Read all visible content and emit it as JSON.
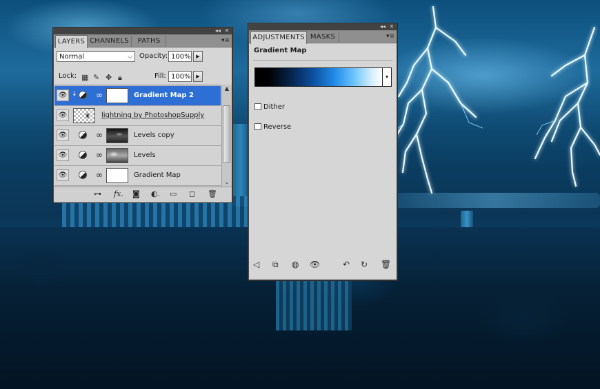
{
  "layers_panel": {
    "tabs": [
      "LAYERS",
      "CHANNELS",
      "PATHS"
    ],
    "blend_mode": "Normal",
    "opacity_label": "Opacity:",
    "opacity_value": "100%",
    "lock_label": "Lock:",
    "fill_label": "Fill:",
    "fill_value": "100%",
    "layers": [
      {
        "name": "Gradient Map 2",
        "selected": true
      },
      {
        "name": "lightning by PhotoshopSupply",
        "selected": false
      },
      {
        "name": "Levels copy",
        "selected": false
      },
      {
        "name": "Levels",
        "selected": false
      },
      {
        "name": "Gradient Map",
        "selected": false
      }
    ],
    "footer_icons": [
      "link-icon",
      "fx-icon",
      "mask-icon",
      "adjustment-icon",
      "folder-icon",
      "new-layer-icon",
      "trash-icon"
    ]
  },
  "adjustments_panel": {
    "tabs": [
      "ADJUSTMENTS",
      "MASKS"
    ],
    "title": "Gradient Map",
    "dither_label": "Dither",
    "reverse_label": "Reverse",
    "dither_checked": false,
    "reverse_checked": false,
    "gradient_colors": [
      "#000000",
      "#06244a",
      "#0c4e9b",
      "#1f8ae5",
      "#6ec4ff",
      "#ffffff"
    ],
    "footer_icons": [
      "back-arrow-icon",
      "clip-icon",
      "visibility-toggle-icon",
      "eye-icon",
      "view-previous-icon",
      "reset-icon",
      "trash-icon"
    ]
  },
  "colors": {
    "panel_bg": "#d6d6d6",
    "selection": "#2e6fd6",
    "tab_bar": "#8f8f8f",
    "header_bar": "#424242"
  }
}
